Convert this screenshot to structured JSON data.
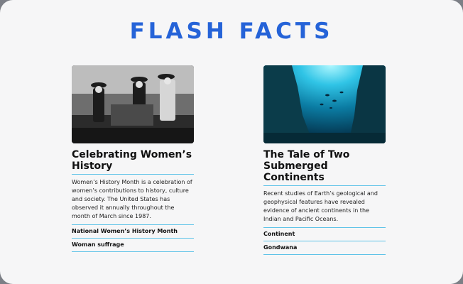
{
  "header": {
    "title": "FLASH FACTS"
  },
  "articles": [
    {
      "title": "Celebrating Women’s History",
      "body": "Women’s History Month is a celebration of women’s contributions to history, culture and society. The United States has observed it annually throughout the month of March since 1987.",
      "tags": [
        "National Women’s History Month",
        "Woman suffrage"
      ],
      "image": "suffrage-parade-photo"
    },
    {
      "title": "The Tale of Two Submerged Continents",
      "body": "Recent studies of Earth’s geological and geophysical features have revealed evidence of ancient continents in the Indian and Pacific Oceans.",
      "tags": [
        "Continent",
        "Gondwana"
      ],
      "image": "underwater-ocean-photo"
    }
  ],
  "colors": {
    "title": "#2563d8",
    "rule": "#5fc3e8",
    "background": "#f6f6f7"
  }
}
